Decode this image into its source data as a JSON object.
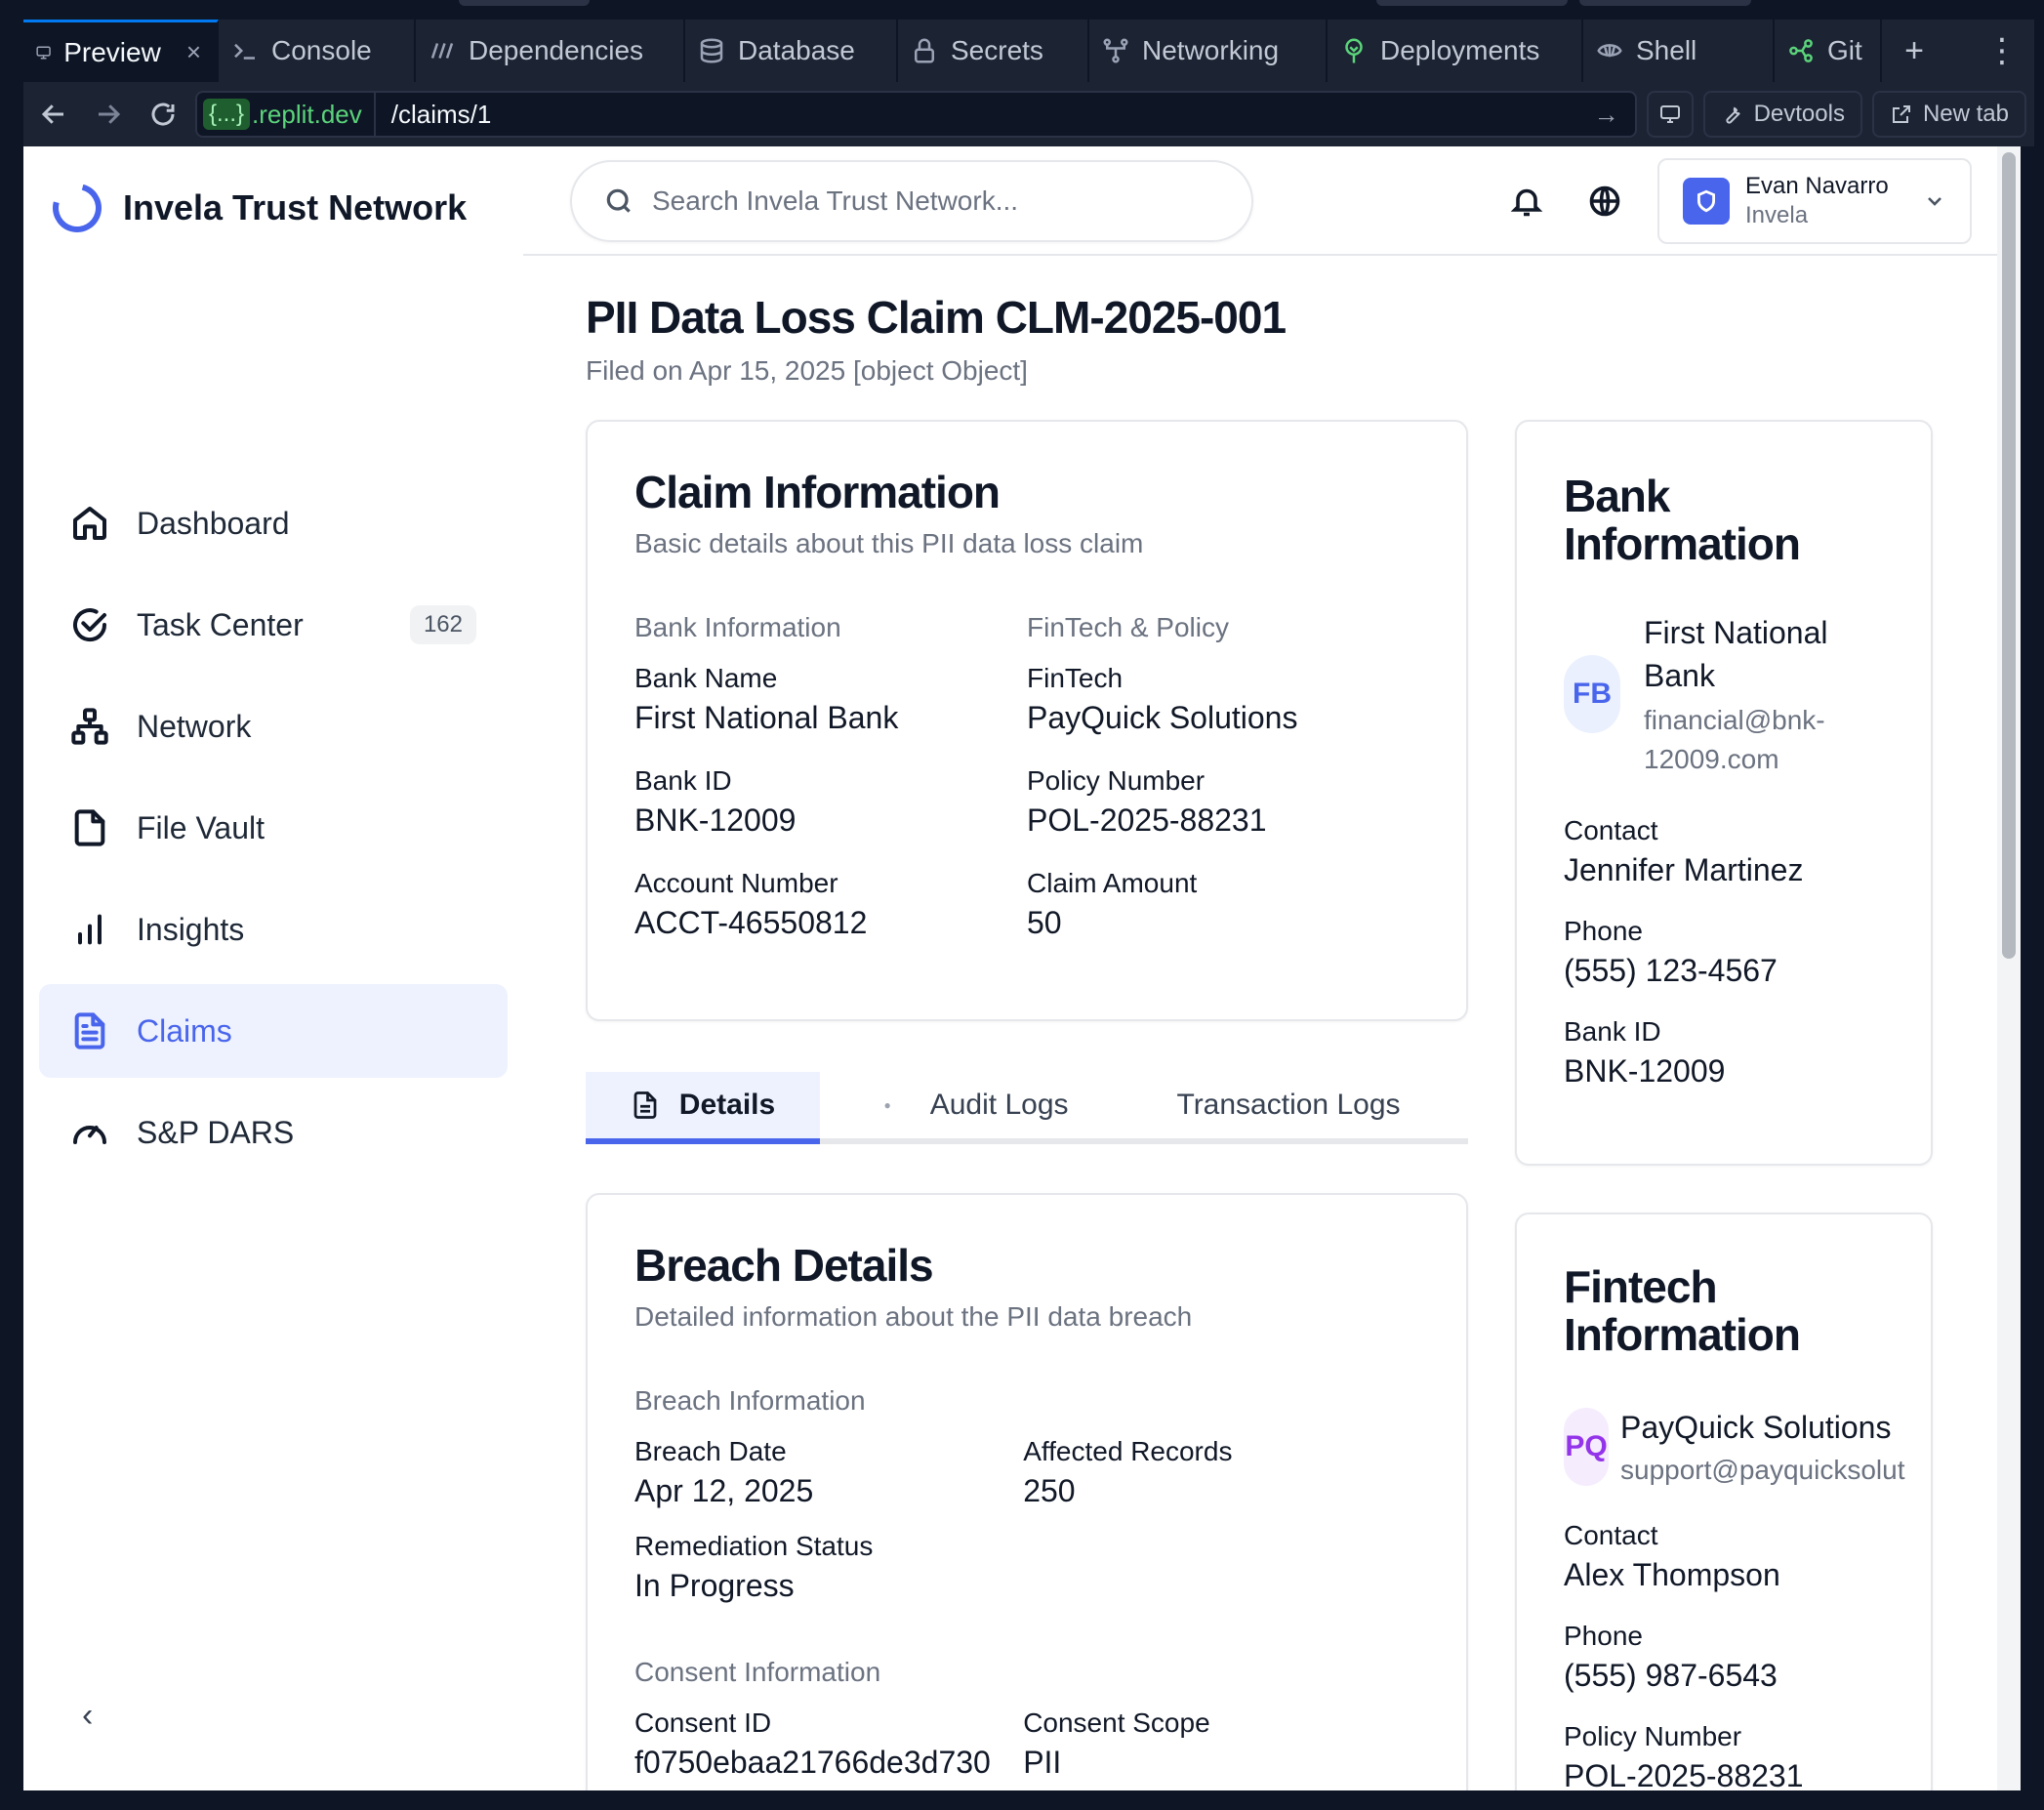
{
  "ide": {
    "tabs": [
      {
        "label": "Preview",
        "icon": "monitor-icon"
      },
      {
        "label": "Console",
        "icon": "terminal-icon"
      },
      {
        "label": "Dependencies",
        "icon": "dependencies-icon"
      },
      {
        "label": "Database",
        "icon": "database-icon"
      },
      {
        "label": "Secrets",
        "icon": "lock-icon"
      },
      {
        "label": "Networking",
        "icon": "network-icon"
      },
      {
        "label": "Deployments",
        "icon": "deploy-icon"
      },
      {
        "label": "Shell",
        "icon": "shell-icon"
      },
      {
        "label": "Git",
        "icon": "git-icon"
      }
    ],
    "close_glyph": "×",
    "new_tab_glyph": "+",
    "more_glyph": "⋮",
    "url_host_brace": "{...}",
    "url_host": ".replit.dev",
    "url_path": "/claims/1",
    "url_go_glyph": "→",
    "devtools_label": "Devtools",
    "newtab_label": "New tab"
  },
  "app": {
    "brand_name": "Invela Trust Network",
    "nav": [
      {
        "label": "Dashboard",
        "badge": ""
      },
      {
        "label": "Task Center",
        "badge": "162"
      },
      {
        "label": "Network",
        "badge": ""
      },
      {
        "label": "File Vault",
        "badge": ""
      },
      {
        "label": "Insights",
        "badge": ""
      },
      {
        "label": "Claims",
        "badge": ""
      },
      {
        "label": "S&P DARS",
        "badge": ""
      }
    ],
    "collapse_glyph": "‹",
    "search_placeholder": "Search Invela Trust Network...",
    "user": {
      "name": "Evan Navarro",
      "org": "Invela"
    },
    "accent": "#4965ec"
  },
  "page": {
    "title": "PII Data Loss Claim CLM-2025-001",
    "subtitle": "Filed on Apr 15, 2025 [object Object]"
  },
  "claim_info": {
    "title": "Claim Information",
    "description": "Basic details about this PII data loss claim",
    "left_heading": "Bank Information",
    "right_heading": "FinTech & Policy",
    "left": [
      {
        "label": "Bank Name",
        "value": "First National Bank"
      },
      {
        "label": "Bank ID",
        "value": "BNK-12009"
      },
      {
        "label": "Account Number",
        "value": "ACCT-46550812"
      }
    ],
    "right": [
      {
        "label": "FinTech",
        "value": "PayQuick Solutions"
      },
      {
        "label": "Policy Number",
        "value": "POL-2025-88231"
      },
      {
        "label": "Claim Amount",
        "value": "50"
      }
    ]
  },
  "tabs": [
    {
      "label": "Details"
    },
    {
      "label": "Audit Logs"
    },
    {
      "label": "Transaction Logs"
    }
  ],
  "breach": {
    "title": "Breach Details",
    "description": "Detailed information about the PII data breach",
    "breach_heading": "Breach Information",
    "breach_left": [
      {
        "label": "Breach Date",
        "value": "Apr 12, 2025"
      },
      {
        "label": "Remediation Status",
        "value": "In Progress"
      }
    ],
    "breach_right": [
      {
        "label": "Affected Records",
        "value": "250"
      }
    ],
    "consent_heading": "Consent Information",
    "consent_left": [
      {
        "label": "Consent ID",
        "value": "f0750ebaa21766de3d730"
      }
    ],
    "consent_right": [
      {
        "label": "Consent Scope",
        "value": "PII"
      }
    ]
  },
  "bank_card": {
    "title_line1": "Bank",
    "title_line2": "Information",
    "initials": "FB",
    "initials_color": "#4965ec",
    "initials_bg": "#eaf0fd",
    "name_line1": "First National",
    "name_line2": "Bank",
    "email_line1": "financial@bnk-",
    "email_line2": "12009.com",
    "fields": [
      {
        "label": "Contact",
        "value": "Jennifer Martinez"
      },
      {
        "label": "Phone",
        "value": "(555) 123-4567"
      },
      {
        "label": "Bank ID",
        "value": "BNK-12009"
      }
    ]
  },
  "fintech_card": {
    "title_line1": "Fintech",
    "title_line2": "Information",
    "initials": "PQ",
    "initials_color": "#9333ea",
    "initials_bg": "#f5ecfd",
    "name": "PayQuick Solutions",
    "email": "support@payquicksolut",
    "fields": [
      {
        "label": "Contact",
        "value": "Alex Thompson"
      },
      {
        "label": "Phone",
        "value": "(555) 987-6543"
      },
      {
        "label": "Policy Number",
        "value": "POL-2025-88231"
      }
    ]
  }
}
